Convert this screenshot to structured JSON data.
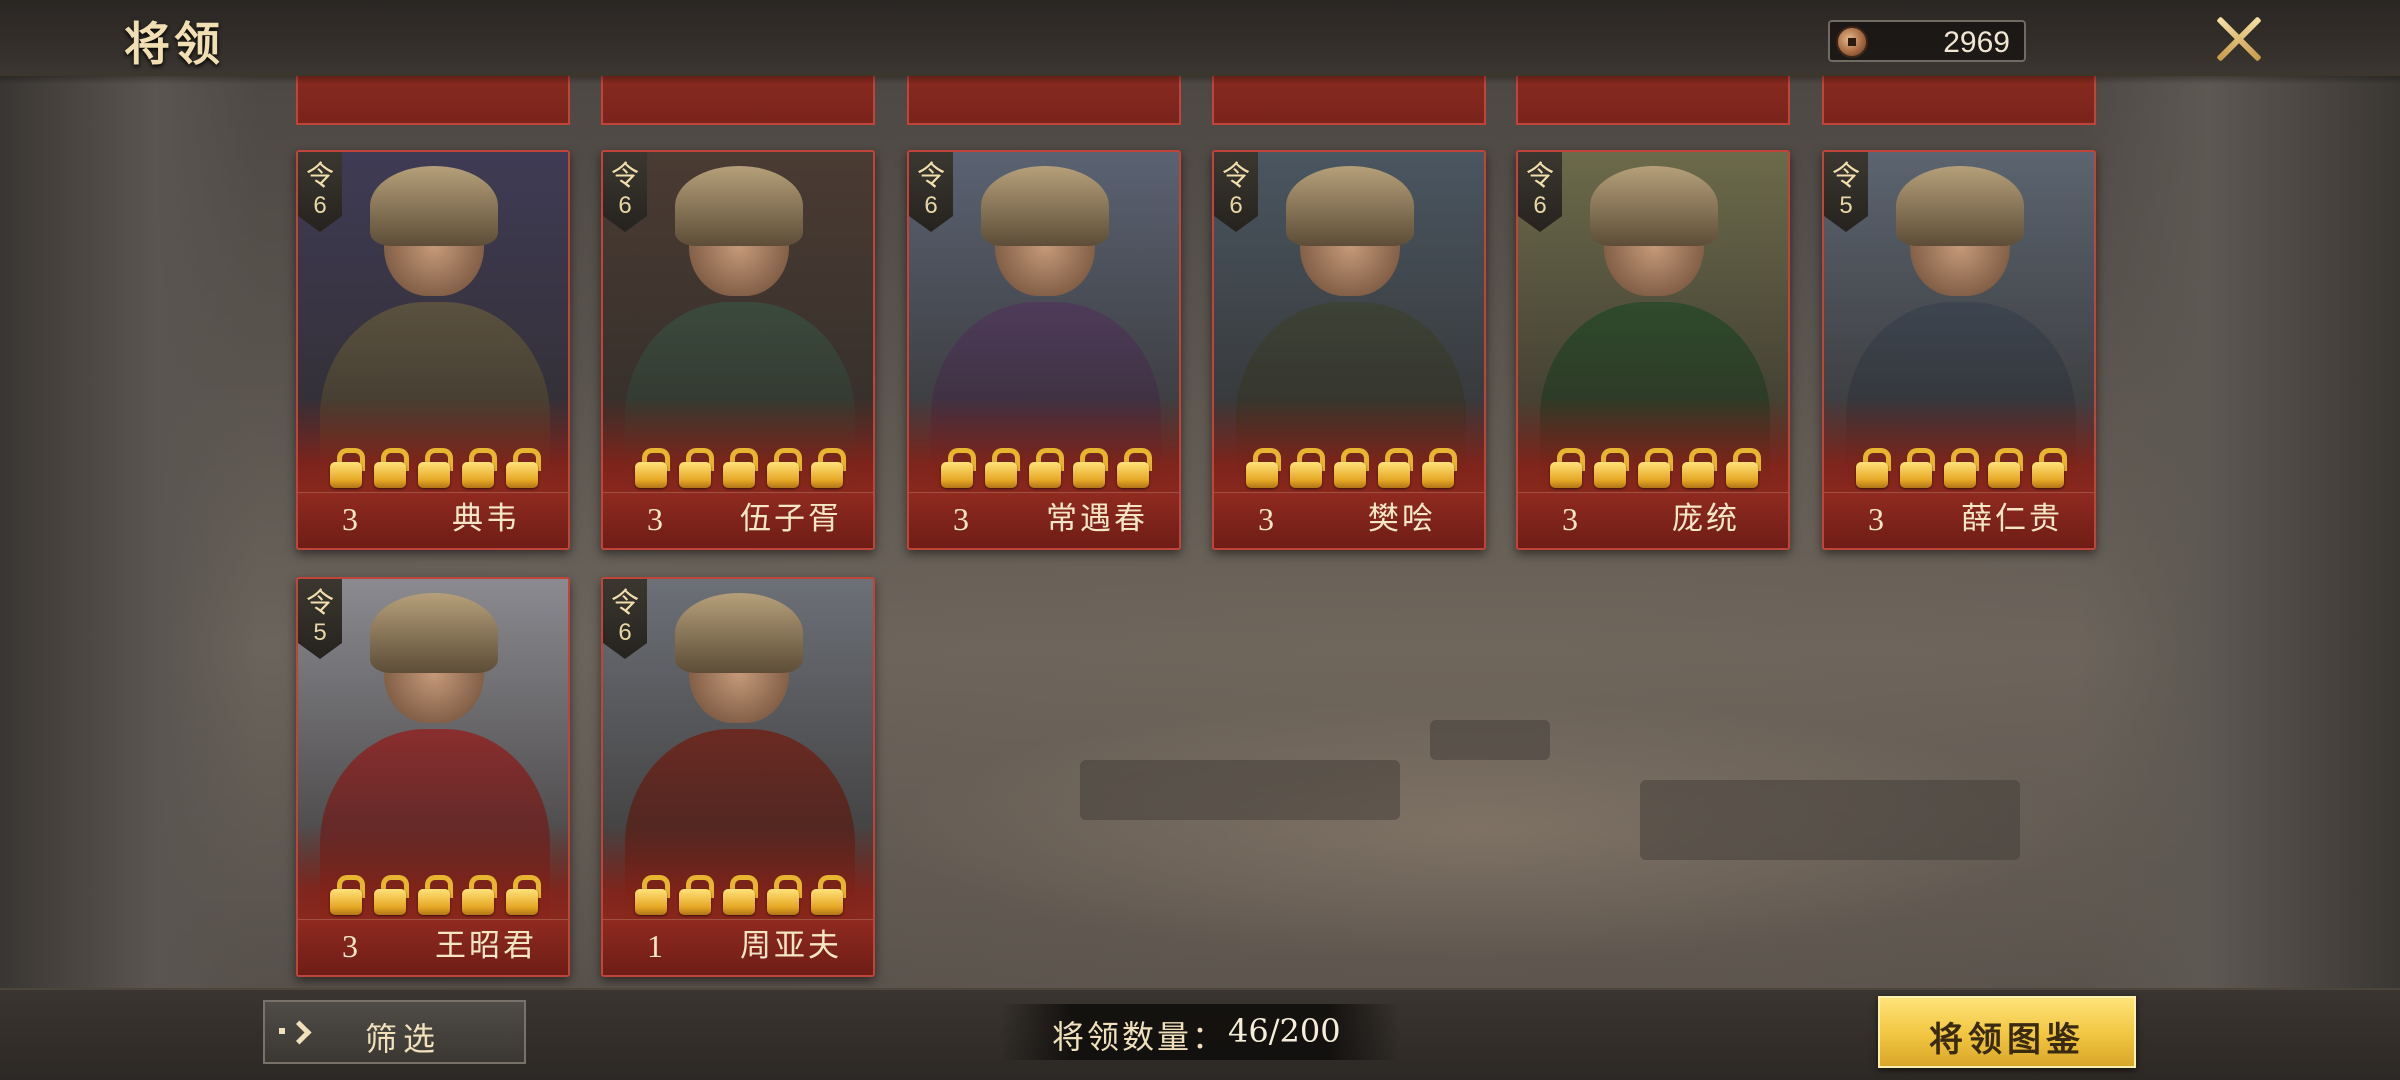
{
  "header": {
    "title": "将领",
    "currency_value": "2969",
    "icons": {
      "currency": "coin-icon",
      "close": "close-icon"
    }
  },
  "cards": [
    {
      "name": "典韦",
      "level": "3",
      "badge_glyph": "令",
      "badge_num": "6",
      "colors": {
        "bg": "#3f3b55",
        "armor": "#5a513f"
      }
    },
    {
      "name": "伍子胥",
      "level": "3",
      "badge_glyph": "令",
      "badge_num": "6",
      "colors": {
        "bg": "#4a3b33",
        "armor": "#3b4a3d"
      }
    },
    {
      "name": "常遇春",
      "level": "3",
      "badge_glyph": "令",
      "badge_num": "6",
      "colors": {
        "bg": "#5a6272",
        "armor": "#4e3b5a"
      }
    },
    {
      "name": "樊哙",
      "level": "3",
      "badge_glyph": "令",
      "badge_num": "6",
      "colors": {
        "bg": "#4a5661",
        "armor": "#3d4236"
      }
    },
    {
      "name": "庞统",
      "level": "3",
      "badge_glyph": "令",
      "badge_num": "6",
      "colors": {
        "bg": "#6b6a4a",
        "armor": "#2f4a2c"
      }
    },
    {
      "name": "薛仁贵",
      "level": "3",
      "badge_glyph": "令",
      "badge_num": "5",
      "colors": {
        "bg": "#5b6470",
        "armor": "#3d4550"
      }
    },
    {
      "name": "王昭君",
      "level": "3",
      "badge_glyph": "令",
      "badge_num": "5",
      "colors": {
        "bg": "#8a8a90",
        "armor": "#8a2e2e"
      }
    },
    {
      "name": "周亚夫",
      "level": "1",
      "badge_glyph": "令",
      "badge_num": "6",
      "colors": {
        "bg": "#6c7077",
        "armor": "#6b2a22"
      }
    }
  ],
  "lock_icon": "lock-icon",
  "footer": {
    "filter_label": "筛选",
    "filter_icon": "arrow-right-icon",
    "count_label": "将领数量：",
    "count_value": "46/200",
    "gallery_label": "将领图鉴"
  },
  "accent_colors": {
    "card_border": "#c0443a",
    "gold": "#f1c53f",
    "text_gold": "#f0e1bc"
  }
}
